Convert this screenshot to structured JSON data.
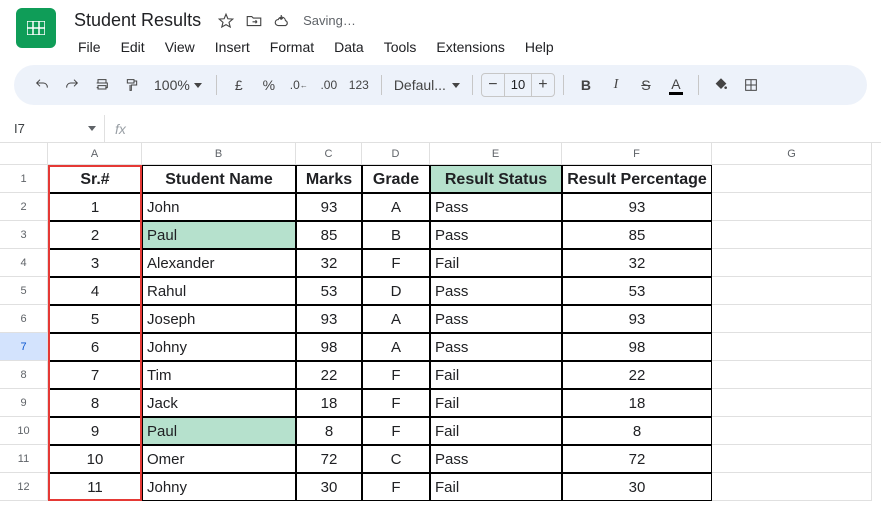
{
  "doc_title": "Student Results",
  "saving_text": "Saving…",
  "menus": [
    "File",
    "Edit",
    "View",
    "Insert",
    "Format",
    "Data",
    "Tools",
    "Extensions",
    "Help"
  ],
  "toolbar": {
    "zoom": "100%",
    "currency": "£",
    "percent": "%",
    "font": "Defaul...",
    "font_size": "10"
  },
  "name_box": "I7",
  "columns": [
    "A",
    "B",
    "C",
    "D",
    "E",
    "F",
    "G"
  ],
  "header_row_num": "1",
  "headers": {
    "a": "Sr.#",
    "b": "Student  Name",
    "c": "Marks",
    "d": "Grade",
    "e": "Result Status",
    "f": "Result Percentage"
  },
  "selected_row": 7,
  "rows": [
    {
      "n": "2",
      "a": "1",
      "b": "John",
      "c": "93",
      "d": "A",
      "e": "Pass",
      "f": "93",
      "hl": false
    },
    {
      "n": "3",
      "a": "2",
      "b": "Paul",
      "c": "85",
      "d": "B",
      "e": "Pass",
      "f": "85",
      "hl": true
    },
    {
      "n": "4",
      "a": "3",
      "b": "Alexander",
      "c": "32",
      "d": "F",
      "e": "Fail",
      "f": "32",
      "hl": false
    },
    {
      "n": "5",
      "a": "4",
      "b": "Rahul",
      "c": "53",
      "d": "D",
      "e": "Pass",
      "f": "53",
      "hl": false
    },
    {
      "n": "6",
      "a": "5",
      "b": "Joseph",
      "c": "93",
      "d": "A",
      "e": "Pass",
      "f": "93",
      "hl": false
    },
    {
      "n": "7",
      "a": "6",
      "b": "Johny",
      "c": "98",
      "d": "A",
      "e": "Pass",
      "f": "98",
      "hl": false
    },
    {
      "n": "8",
      "a": "7",
      "b": "Tim",
      "c": "22",
      "d": "F",
      "e": "Fail",
      "f": "22",
      "hl": false
    },
    {
      "n": "9",
      "a": "8",
      "b": "Jack",
      "c": "18",
      "d": "F",
      "e": "Fail",
      "f": "18",
      "hl": false
    },
    {
      "n": "10",
      "a": "9",
      "b": "Paul",
      "c": "8",
      "d": "F",
      "e": "Fail",
      "f": "8",
      "hl": true
    },
    {
      "n": "11",
      "a": "10",
      "b": "Omer",
      "c": "72",
      "d": "C",
      "e": "Pass",
      "f": "72",
      "hl": false
    },
    {
      "n": "12",
      "a": "11",
      "b": "Johny",
      "c": "30",
      "d": "F",
      "e": "Fail",
      "f": "30",
      "hl": false
    }
  ]
}
